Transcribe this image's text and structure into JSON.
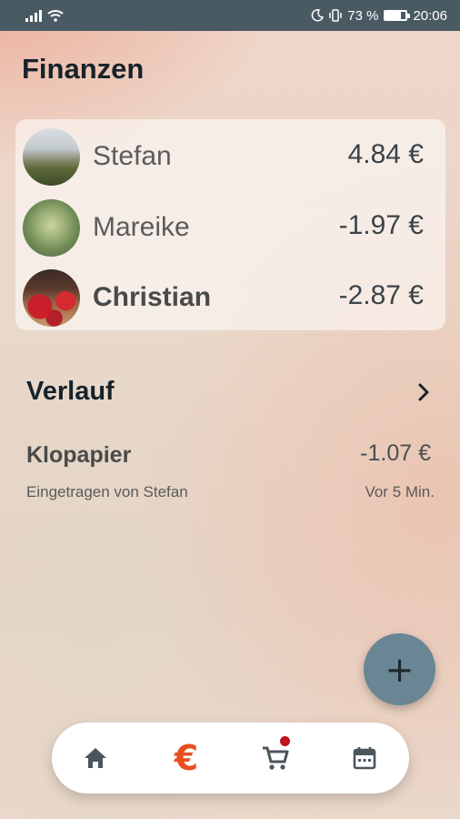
{
  "statusbar": {
    "battery": "73 %",
    "time": "20:06"
  },
  "page": {
    "title": "Finanzen"
  },
  "balances": [
    {
      "name": "Stefan",
      "amount": "4.84 €",
      "bold": false
    },
    {
      "name": "Mareike",
      "amount": "-1.97 €",
      "bold": false
    },
    {
      "name": "Christian",
      "amount": "-2.87 €",
      "bold": true
    }
  ],
  "history": {
    "title": "Verlauf",
    "items": [
      {
        "title": "Klopapier",
        "amount": "-1.07 €",
        "subtitle": "Eingetragen von Stefan",
        "time": "Vor 5 Min."
      }
    ]
  },
  "fab": {
    "label": "+",
    "icon": "plus-icon"
  },
  "nav": {
    "items": [
      {
        "icon": "home-icon"
      },
      {
        "icon": "euro-icon",
        "label": "€",
        "active": true
      },
      {
        "icon": "cart-icon",
        "badge": true
      },
      {
        "icon": "calendar-icon"
      }
    ]
  },
  "colors": {
    "accent": "#e8501f",
    "fab": "#6a8593",
    "statusbar": "#4a5a63",
    "badge": "#c0131c"
  }
}
